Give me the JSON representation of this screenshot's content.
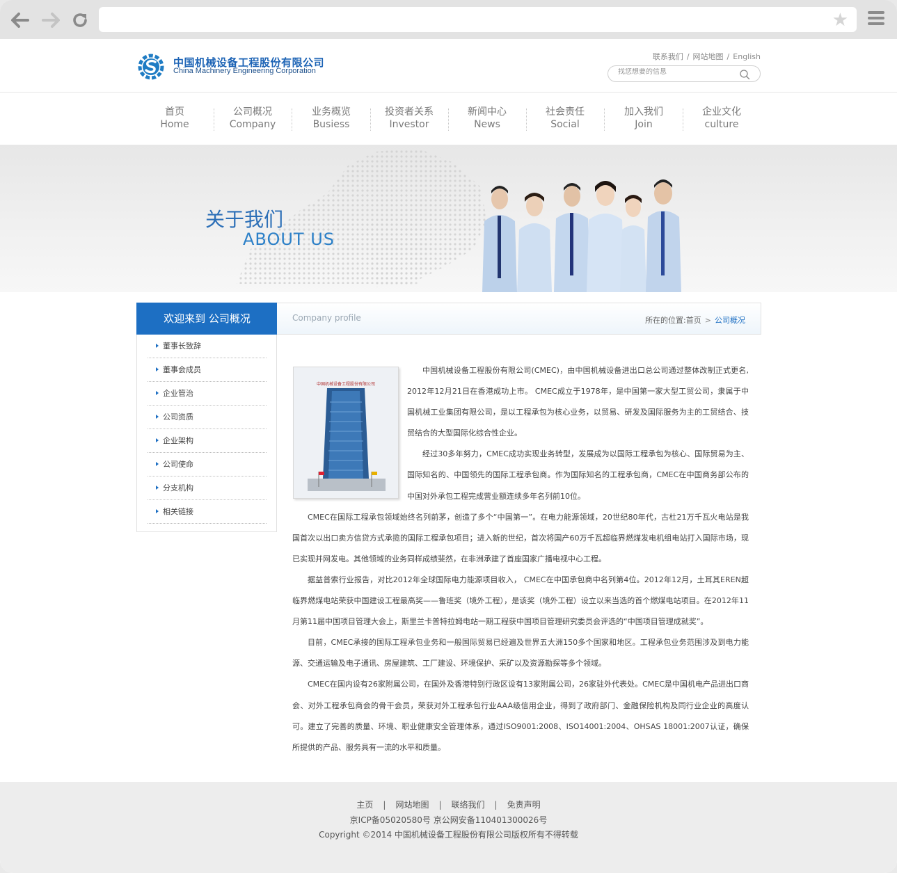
{
  "browser": {
    "star_glyph": "★"
  },
  "header": {
    "logo_cn": "中国机械设备工程股份有限公司",
    "logo_en": "China Machinery Engineering Corporation",
    "links": [
      "联系我们",
      "网站地图",
      "English"
    ],
    "link_sep": "/",
    "search_placeholder": "找您想要的信息"
  },
  "nav": [
    {
      "cn": "首页",
      "en": "Home"
    },
    {
      "cn": "公司概况",
      "en": "Company"
    },
    {
      "cn": "业务概览",
      "en": "Busiess"
    },
    {
      "cn": "投资者关系",
      "en": "Investor"
    },
    {
      "cn": "新闻中心",
      "en": "News"
    },
    {
      "cn": "社会责任",
      "en": "Social"
    },
    {
      "cn": "加入我们",
      "en": "Join"
    },
    {
      "cn": "企业文化",
      "en": "culture"
    }
  ],
  "banner": {
    "title_cn": "关于我们",
    "title_en": "ABOUT US"
  },
  "sidebar": {
    "title": "欢迎来到 公司概况",
    "items": [
      "董事长致辞",
      "董事会成员",
      "企业管治",
      "公司资质",
      "企业架构",
      "公司使命",
      "分支机构",
      "相关链接"
    ]
  },
  "content": {
    "title": "Company profile",
    "crumb_prefix": "所在的位置:",
    "crumb_home": "首页",
    "crumb_arrow": ">",
    "crumb_current": "公司概况",
    "photo_caption": "中国机械设备工程股份有限公司",
    "paragraphs": [
      "中国机械设备工程股份有限公司(CMEC)，由中国机械设备进出口总公司通过整体改制正式更名, 2012年12月21日在香港成功上市。 CMEC成立于1978年，是中国第一家大型工贸公司，隶属于中国机械工业集团有限公司，是以工程承包为核心业务，以贸易、研发及国际服务为主的工贸结合、技贸结合的大型国际化综合性企业。",
      "经过30多年努力，CMEC成功实现业务转型，发展成为以国际工程承包为核心、国际贸易为主、国际知名的、中国领先的国际工程承包商。作为国际知名的工程承包商，CMEC在中国商务部公布的中国对外承包工程完成营业额连续多年名列前10位。",
      "CMEC在国际工程承包领域始终名列前茅，创造了多个“中国第一”。在电力能源领域，20世纪80年代，古杜21万千瓦火电站是我国首次以出口卖方信贷方式承揽的国际工程承包项目；进入新的世纪，首次将国产60万千瓦超临界燃煤发电机组电站打入国际市场，现已实现并网发电。其他领域的业务同样成绩斐然，在非洲承建了首座国家广播电视中心工程。",
      "据益普索行业报告，对比2012年全球国际电力能源项目收入， CMEC在中国承包商中名列第4位。2012年12月，土耳其EREN超临界燃煤电站荣获中国建设工程最高奖——鲁班奖（境外工程），是该奖（境外工程）设立以来当选的首个燃煤电站项目。在2012年11月第11届中国项目管理大会上，斯里兰卡普特拉姆电站一期工程获中国项目管理研究委员会评选的“中国项目管理成就奖”。",
      "目前，CMEC承接的国际工程承包业务和一般国际贸易已经遍及世界五大洲150多个国家和地区。工程承包业务范围涉及到电力能源、交通运输及电子通讯、房屋建筑、工厂建设、环境保护、采矿以及资源勘探等多个领域。",
      "CMEC在国内设有26家附属公司，在国外及香港特别行政区设有13家附属公司，26家驻外代表处。CMEC是中国机电产品进出口商会、对外工程承包商会的骨干会员，荣获对外工程承包行业AAA级信用企业，得到了政府部门、金融保险机构及同行业企业的高度认可。建立了完善的质量、环境、职业健康安全管理体系，通过ISO9001:2008、ISO14001:2004、OHSAS 18001:2007认证，确保所提供的产品、服务具有一流的水平和质量。"
    ]
  },
  "footer": {
    "links": [
      "主页",
      "网站地图",
      "联络我们",
      "免责声明"
    ],
    "link_sep": "|",
    "icp": "京ICP备05020580号    京公网安备110401300026号",
    "copyright": "Copyright ©2014 中国机械设备工程股份有限公司版权所有不得转载"
  },
  "colors": {
    "brand_blue": "#1d6fc3",
    "banner_title": "#2c6fb7"
  }
}
